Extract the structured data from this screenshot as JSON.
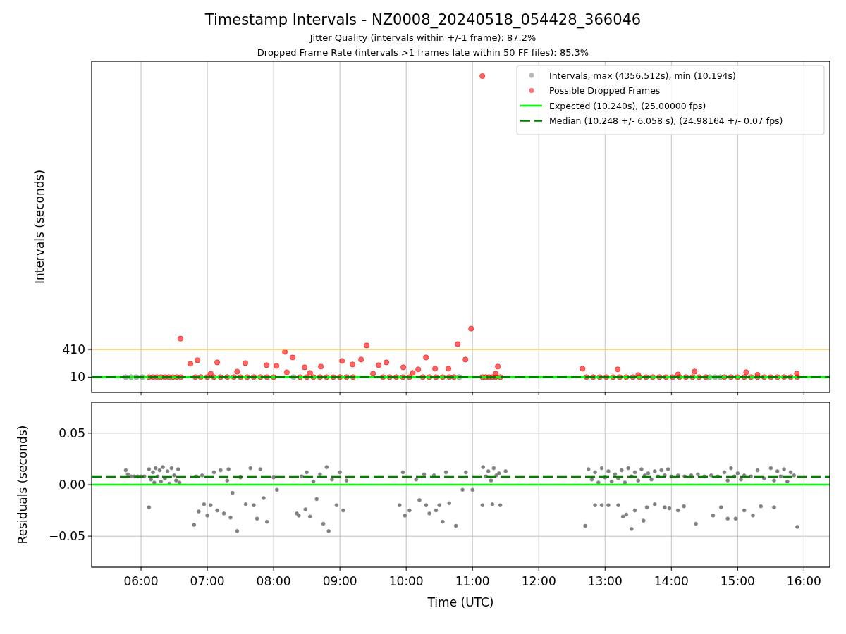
{
  "figure": {
    "title": "Timestamp Intervals - NZ0008_20240518_054428_366046",
    "subtitles": [
      "Jitter Quality (intervals within +/-1 frame): 87.2%",
      "Dropped Frame Rate (intervals >1 frames late within 50 FF files): 85.3%"
    ]
  },
  "charts": [
    {
      "chart_data": {
        "type": "scatter",
        "ylabel": "Intervals (seconds)",
        "xlim": [
          5.255,
          16.39
        ],
        "ylim": [
          -210,
          4570
        ],
        "yticks": [
          {
            "value": 10,
            "label": "10"
          },
          {
            "value": 410,
            "label": "410"
          }
        ],
        "grid": "x",
        "legend": "upper right",
        "ref_lines": [
          {
            "axis": "y",
            "value": 410,
            "color": "#ffc84d"
          },
          {
            "axis": "y",
            "value": 10.24,
            "label": "Expected (10.240s), (25.00000 fps)",
            "color": "#00ff00"
          },
          {
            "axis": "y",
            "value": 10.248,
            "label": "Median (10.248 +/- 6.058 s), (24.98164 +/- 0.07 fps)",
            "color": "#008000"
          }
        ],
        "series": [
          {
            "name": "Intervals, max (4356.512s), min (10.194s)",
            "color": "#808080",
            "x": [
              5.77,
              5.85,
              5.93,
              6.02,
              8.3,
              10.8,
              14.58,
              14.66,
              14.74
            ],
            "values": [
              10.2,
              10.2,
              10.2,
              10.2,
              10.2,
              10.2,
              10.2,
              10.2,
              10.2
            ]
          },
          {
            "name": "Possible Dropped Frames",
            "color": "#ff0000",
            "x": [
              6.596,
              11.149,
              10.979,
              10.777,
              9.404,
              8.17,
              10.298,
              8.287,
              9.032,
              10.894,
              6.745,
              6.851,
              7.149,
              7.574,
              7.894,
              8.043,
              8.468,
              8.713,
              9.191,
              9.319,
              9.585,
              9.702,
              9.957,
              10.181,
              10.436,
              10.638,
              11.383,
              12.66,
              13.191,
              14.351,
              15.128,
              15.894,
              7.05,
              7.45,
              8.2,
              8.55,
              9.5,
              10.1,
              11.35,
              13.5,
              14.1,
              15.3,
              6.12,
              6.18,
              6.24,
              6.3,
              6.36,
              6.42,
              6.48,
              6.54,
              6.6,
              6.82,
              6.9,
              7.0,
              7.1,
              7.2,
              7.3,
              7.4,
              7.5,
              7.6,
              7.7,
              7.8,
              7.9,
              8.0,
              8.4,
              8.5,
              8.6,
              8.7,
              8.8,
              8.9,
              9.0,
              9.1,
              9.2,
              9.65,
              9.75,
              9.85,
              9.95,
              10.05,
              10.25,
              10.35,
              10.45,
              10.55,
              10.65,
              10.72,
              11.15,
              11.2,
              11.25,
              11.3,
              11.35,
              11.42,
              12.72,
              12.82,
              12.92,
              13.02,
              13.12,
              13.22,
              13.32,
              13.42,
              13.52,
              13.62,
              13.72,
              13.82,
              13.92,
              14.02,
              14.12,
              14.22,
              14.32,
              14.42,
              14.52,
              14.8,
              14.9,
              15.0,
              15.1,
              15.2,
              15.3,
              15.4,
              15.5,
              15.6,
              15.7,
              15.8,
              15.9
            ],
            "values": [
              566,
              4356.5,
              710,
              487,
              467,
              375,
              294,
              294,
              243,
              264,
              203,
              254,
              223,
              213,
              183,
              172,
              152,
              162,
              193,
              264,
              183,
              223,
              152,
              122,
              132,
              132,
              162,
              132,
              122,
              91,
              81,
              61,
              60,
              90,
              80,
              70,
              60,
              70,
              60,
              40,
              50,
              45,
              10.5,
              10.5,
              10.5,
              10.5,
              10.5,
              10.5,
              10.5,
              10.5,
              10.5,
              10.5,
              10.5,
              10.5,
              10.5,
              10.5,
              10.5,
              10.5,
              10.5,
              10.5,
              10.5,
              10.5,
              10.5,
              10.5,
              10.5,
              10.5,
              10.5,
              10.5,
              10.5,
              10.5,
              10.5,
              10.5,
              10.5,
              10.5,
              10.5,
              10.5,
              10.5,
              10.5,
              10.5,
              10.5,
              10.5,
              10.5,
              10.5,
              10.5,
              10.5,
              10.5,
              10.5,
              10.5,
              10.5,
              10.5,
              10.5,
              10.5,
              10.5,
              10.5,
              10.5,
              10.5,
              10.5,
              10.5,
              10.5,
              10.5,
              10.5,
              10.5,
              10.5,
              10.5,
              10.5,
              10.5,
              10.5,
              10.5,
              10.5,
              10.5,
              10.5,
              10.5,
              10.5,
              10.5,
              10.5,
              10.5,
              10.5,
              10.5,
              10.5,
              10.5,
              10.5
            ]
          }
        ]
      }
    },
    {
      "chart_data": {
        "type": "scatter",
        "xlabel": "Time (UTC)",
        "ylabel": "Residuals (seconds)",
        "xlim": [
          5.255,
          16.39
        ],
        "ylim": [
          -0.08,
          0.08
        ],
        "xticks": [
          {
            "value": 6,
            "label": "06:00"
          },
          {
            "value": 7,
            "label": "07:00"
          },
          {
            "value": 8,
            "label": "08:00"
          },
          {
            "value": 9,
            "label": "09:00"
          },
          {
            "value": 10,
            "label": "10:00"
          },
          {
            "value": 11,
            "label": "11:00"
          },
          {
            "value": 12,
            "label": "12:00"
          },
          {
            "value": 13,
            "label": "13:00"
          },
          {
            "value": 14,
            "label": "14:00"
          },
          {
            "value": 15,
            "label": "15:00"
          },
          {
            "value": 16,
            "label": "16:00"
          }
        ],
        "yticks": [
          {
            "value": 0.05,
            "label": "0.05"
          },
          {
            "value": 0,
            "label": "0.00"
          },
          {
            "value": -0.05,
            "label": "−0.05"
          }
        ],
        "grid": "both",
        "ref_lines": [
          {
            "axis": "y",
            "value": 0,
            "color": "#00ff00"
          },
          {
            "axis": "y",
            "value": 0.0075,
            "color": "#008000"
          }
        ],
        "series": [
          {
            "color": "#808080",
            "x": [
              5.77,
              5.8,
              5.85,
              5.9,
              5.95,
              6.0,
              6.05,
              6.12,
              6.15,
              6.18,
              6.2,
              6.22,
              6.25,
              6.28,
              6.3,
              6.33,
              6.36,
              6.4,
              6.43,
              6.46,
              6.5,
              6.53,
              6.56,
              6.58,
              6.12,
              6.8,
              6.83,
              6.87,
              6.92,
              6.95,
              7.0,
              7.05,
              7.1,
              7.15,
              7.2,
              7.25,
              7.3,
              7.32,
              7.35,
              7.38,
              7.45,
              7.5,
              7.58,
              7.65,
              7.7,
              7.75,
              7.8,
              7.85,
              7.9,
              8.0,
              8.05,
              8.35,
              8.38,
              8.42,
              8.48,
              8.5,
              8.55,
              8.6,
              8.65,
              8.7,
              8.75,
              8.8,
              8.83,
              8.88,
              8.95,
              9.0,
              9.05,
              9.1,
              9.9,
              9.95,
              9.98,
              10.05,
              10.15,
              10.2,
              10.27,
              10.3,
              10.35,
              10.42,
              10.45,
              10.5,
              10.55,
              10.6,
              10.65,
              10.75,
              10.85,
              10.9,
              11.16,
              11.2,
              11.24,
              11.28,
              11.32,
              11.36,
              11.4,
              11.15,
              11.3,
              11.42,
              11.5,
              11.0,
              12.7,
              12.75,
              12.8,
              12.85,
              12.9,
              12.95,
              13.0,
              13.05,
              13.1,
              13.15,
              13.2,
              13.25,
              13.3,
              13.35,
              13.4,
              13.45,
              13.5,
              13.55,
              13.6,
              13.65,
              13.7,
              13.75,
              13.8,
              13.85,
              13.9,
              13.95,
              14.0,
              14.1,
              14.2,
              14.3,
              14.4,
              14.5,
              14.6,
              14.7,
              14.8,
              14.85,
              14.9,
              14.95,
              15.0,
              15.05,
              15.1,
              15.2,
              15.3,
              15.4,
              15.5,
              15.55,
              15.6,
              15.65,
              15.7,
              15.75,
              15.8,
              15.85,
              15.9,
              12.85,
              12.95,
              13.05,
              13.2,
              13.27,
              13.32,
              13.4,
              13.45,
              13.58,
              13.63,
              13.75,
              13.9,
              13.97,
              14.1,
              14.19,
              14.37,
              14.63,
              14.75,
              14.85,
              14.97,
              15.1,
              15.23,
              15.35,
              15.55
            ],
            "values": [
              0.014,
              0.01,
              0.008,
              0.008,
              0.008,
              0.008,
              0.008,
              0.015,
              0.005,
              0.012,
              0.002,
              0.016,
              0.008,
              0.014,
              0.003,
              0.017,
              0.006,
              0.013,
              0.001,
              0.016,
              0.009,
              0.004,
              0.015,
              0.002,
              -0.022,
              -0.039,
              0.008,
              -0.026,
              0.009,
              -0.019,
              -0.03,
              -0.02,
              0.012,
              -0.025,
              0.014,
              -0.028,
              0.004,
              0.015,
              -0.032,
              -0.008,
              -0.045,
              0.007,
              -0.019,
              0.016,
              -0.02,
              -0.033,
              0.015,
              -0.013,
              -0.036,
              0.007,
              -0.005,
              -0.028,
              -0.03,
              0.008,
              -0.024,
              0.012,
              -0.031,
              0.003,
              -0.014,
              0.01,
              -0.038,
              0.017,
              -0.045,
              0.005,
              -0.02,
              0.012,
              -0.025,
              0.004,
              -0.02,
              0.012,
              -0.03,
              -0.025,
              0.005,
              -0.015,
              0.01,
              -0.02,
              -0.028,
              0.009,
              -0.025,
              -0.02,
              -0.036,
              0.012,
              -0.018,
              -0.04,
              -0.005,
              0.012,
              0.017,
              0.008,
              0.013,
              0.004,
              0.016,
              0.009,
              0.011,
              -0.02,
              -0.019,
              -0.02,
              0.013,
              -0.005,
              -0.04,
              0.015,
              0.005,
              0.012,
              0.002,
              0.016,
              0.007,
              0.013,
              0.003,
              0.01,
              0.006,
              0.014,
              0.002,
              0.016,
              0.008,
              0.012,
              0.004,
              0.015,
              0.009,
              0.011,
              0.005,
              0.013,
              0.008,
              0.014,
              0.009,
              0.015,
              0.008,
              0.009,
              0.008,
              0.009,
              0.01,
              0.008,
              0.009,
              0.008,
              0.012,
              0.004,
              0.016,
              0.008,
              0.011,
              0.005,
              0.009,
              0.008,
              0.014,
              0.006,
              0.016,
              0.004,
              0.013,
              0.008,
              0.015,
              0.003,
              0.012,
              0.009,
              -0.041,
              -0.02,
              -0.02,
              -0.02,
              -0.02,
              -0.031,
              -0.029,
              -0.043,
              -0.025,
              -0.035,
              -0.022,
              -0.019,
              -0.022,
              -0.023,
              -0.025,
              -0.021,
              -0.038,
              -0.03,
              -0.022,
              -0.033,
              -0.033,
              -0.025,
              -0.03,
              -0.021,
              -0.022
            ]
          }
        ]
      }
    }
  ]
}
